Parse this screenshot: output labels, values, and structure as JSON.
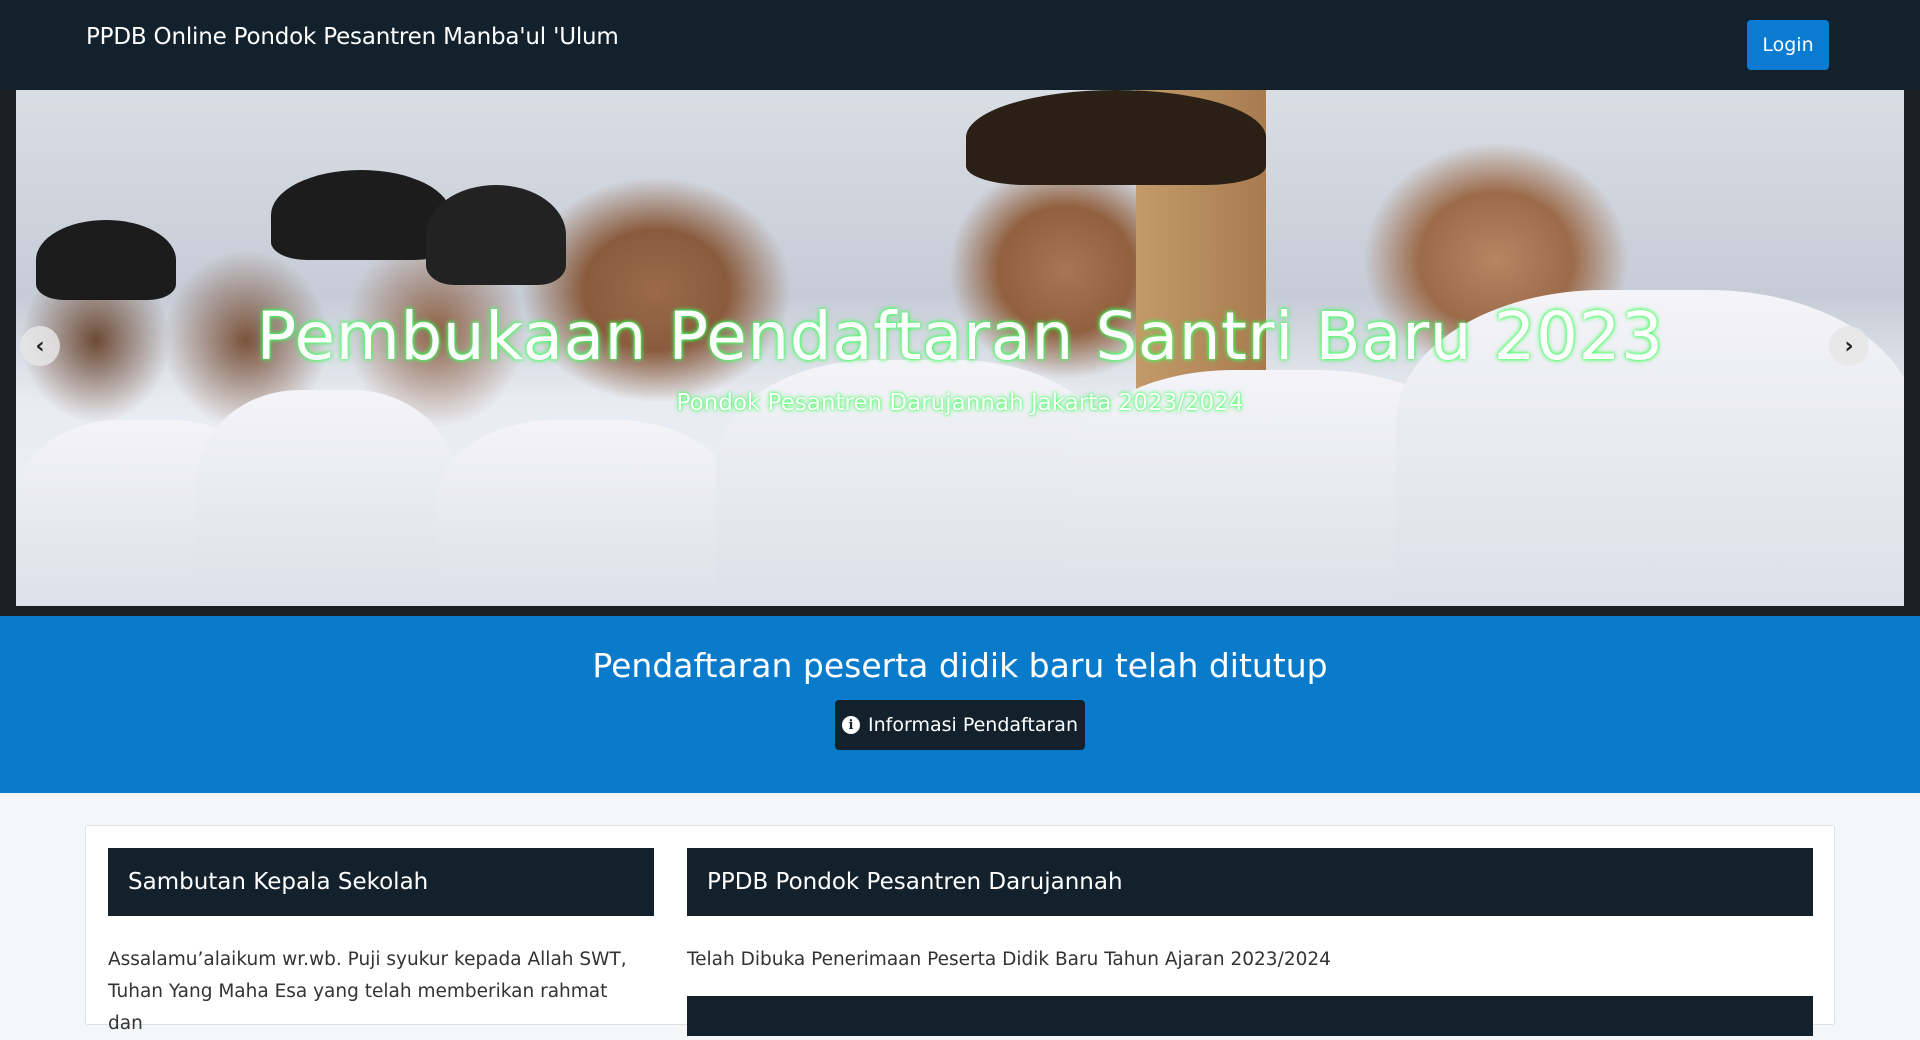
{
  "navbar": {
    "brand": "PPDB Online Pondok Pesantren Manba'ul 'Ulum",
    "login_label": "Login"
  },
  "hero": {
    "title": "Pembukaan Pendaftaran Santri Baru 2023",
    "subtitle": "Pondok Pesantren Darujannah Jakarta 2023/2024",
    "prev_icon": "chevron-left-icon",
    "next_icon": "chevron-right-icon",
    "caption_glow_color": "#3cff59"
  },
  "announcement": {
    "text": "Pendaftaran peserta didik baru telah ditutup",
    "button_label": "Informasi Pendaftaran",
    "button_icon": "info-circle-icon",
    "background_color": "#0a7bcb"
  },
  "cards": {
    "left": {
      "title": "Sambutan Kepala Sekolah",
      "text": "Assalamu’alaikum wr.wb. Puji syukur kepada Allah SWT, Tuhan Yang Maha Esa yang telah memberikan rahmat dan"
    },
    "right": {
      "title": "PPDB Pondok Pesantren Darujannah",
      "text": "Telah Dibuka Penerimaan Peserta Didik Baru Tahun Ajaran 2023/2024"
    }
  },
  "colors": {
    "navbar": "#13212d",
    "primary": "#0a7bd0",
    "dark": "#13212d"
  }
}
